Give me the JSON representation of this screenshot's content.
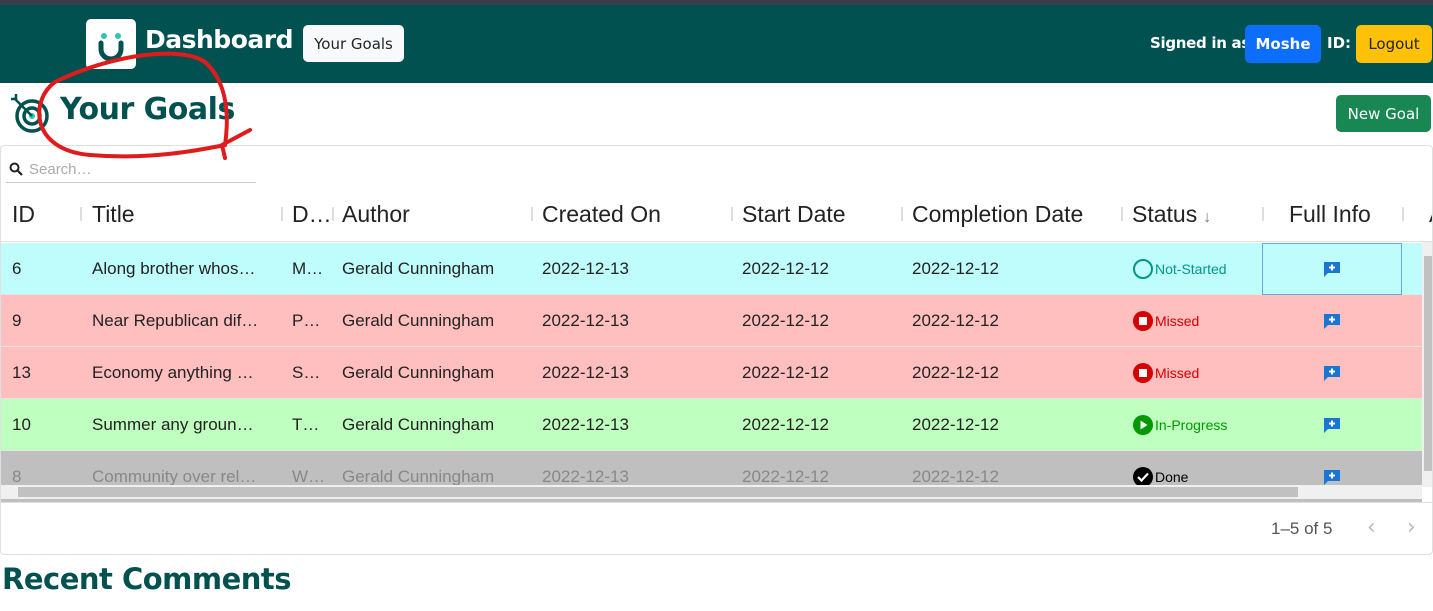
{
  "navbar": {
    "brand": "Dashboard",
    "nav_button": "Your Goals",
    "signed_in_label": "Signed in as",
    "username": "Moshe",
    "id_label": "ID:",
    "logout": "Logout",
    "color": "#015151"
  },
  "page": {
    "title": "Your Goals",
    "new_goal": "New Goal",
    "section2_title": "Recent Comments"
  },
  "grid": {
    "search_placeholder": "Search…",
    "columns": [
      "ID",
      "Title",
      "D…",
      "Author",
      "Created On",
      "Start Date",
      "Completion Date",
      "Status",
      "Full Info",
      "A"
    ],
    "sort_indicator": "↓",
    "rows": [
      {
        "id": "6",
        "title": "Along brother whos…",
        "desc": "M…",
        "author": "Gerald Cunningham",
        "created": "2022-12-13",
        "start": "2022-12-12",
        "completion": "2022-12-12",
        "status": "Not-Started",
        "status_icon": "circle-outline-icon",
        "bg": "#bffcfc",
        "status_color": "#009688"
      },
      {
        "id": "9",
        "title": "Near Republican dif…",
        "desc": "P…",
        "author": "Gerald Cunningham",
        "created": "2022-12-13",
        "start": "2022-12-12",
        "completion": "2022-12-12",
        "status": "Missed",
        "status_icon": "stop-circle-icon",
        "bg": "#ffbfbf",
        "status_color": "#d50000"
      },
      {
        "id": "13",
        "title": "Economy anything …",
        "desc": "S…",
        "author": "Gerald Cunningham",
        "created": "2022-12-13",
        "start": "2022-12-12",
        "completion": "2022-12-12",
        "status": "Missed",
        "status_icon": "stop-circle-icon",
        "bg": "#ffbfbf",
        "status_color": "#d50000"
      },
      {
        "id": "10",
        "title": "Summer any groun…",
        "desc": "T…",
        "author": "Gerald Cunningham",
        "created": "2022-12-13",
        "start": "2022-12-12",
        "completion": "2022-12-12",
        "status": "In-Progress",
        "status_icon": "play-circle-icon",
        "bg": "#bfffbf",
        "status_color": "#009a00"
      },
      {
        "id": "8",
        "title": "Community over rel…",
        "desc": "W…",
        "author": "Gerald Cunningham",
        "created": "2022-12-13",
        "start": "2022-12-12",
        "completion": "2022-12-12",
        "status": "Done",
        "status_icon": "check-circle-icon",
        "bg": "#bfbfbf",
        "status_color": "#000000"
      }
    ],
    "pagination": "1–5 of 5",
    "prev": "‹",
    "next": "›"
  }
}
